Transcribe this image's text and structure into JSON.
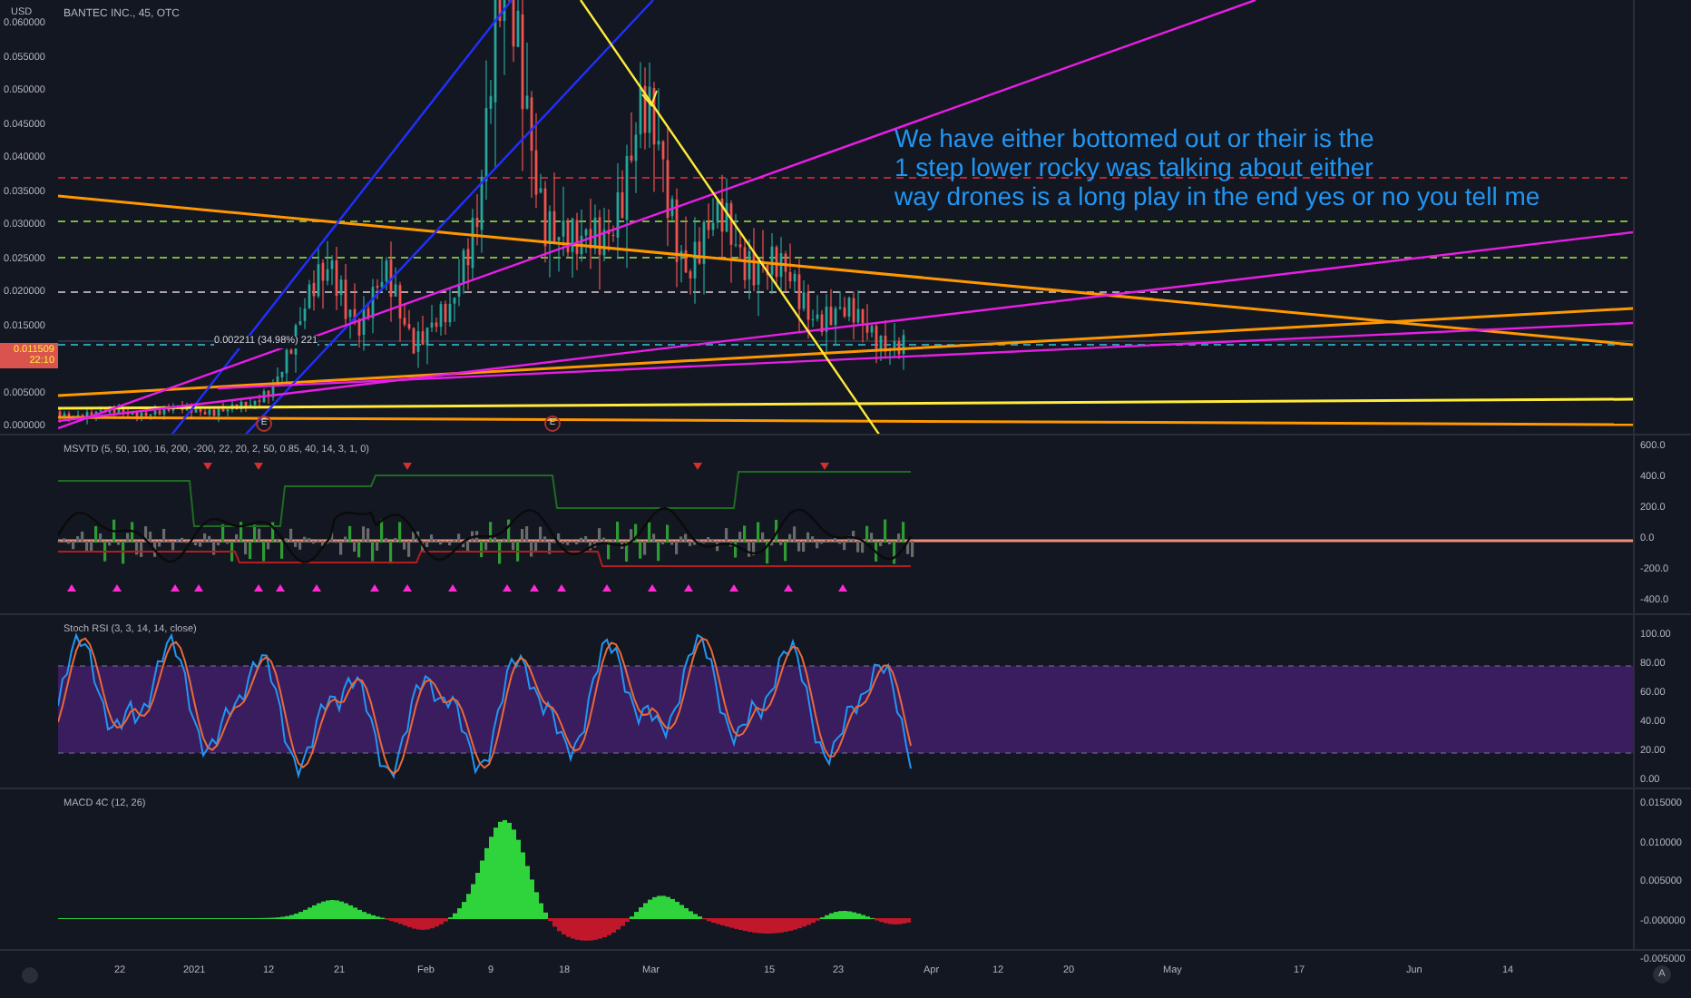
{
  "header": {
    "currency": "USD",
    "symbol": "BANTEC INC., 45, OTC"
  },
  "price_axis": {
    "labels": [
      "0.060000",
      "0.055000",
      "0.050000",
      "0.045000",
      "0.040000",
      "0.035000",
      "0.030000",
      "0.025000",
      "0.020000",
      "0.015000",
      "0.005000",
      "0.000000"
    ],
    "last_price": "0.011509",
    "countdown": "22:10"
  },
  "main_chart": {
    "measure_label": "0.002211 (34.98%) 221",
    "earnings_markers": [
      "E",
      "E"
    ],
    "note_lines": [
      "We have either bottomed out or their is the",
      "1 step lower rocky was talking about either",
      "way drones is a long play in the end yes or no you tell me"
    ]
  },
  "panes": [
    {
      "kind": "msvtd",
      "title": "MSVTD (5, 50, 100, 16, 200, -200, 22, 20, 2, 50, 0.85, 40, 14, 3, 1, 0)",
      "axis": [
        "600.0",
        "400.0",
        "200.0",
        "0.0",
        "-200.0",
        "-400.0"
      ]
    },
    {
      "kind": "stoch",
      "title": "Stoch RSI (3, 3, 14, 14, close)",
      "axis": [
        "100.00",
        "80.00",
        "60.00",
        "40.00",
        "20.00",
        "0.00"
      ]
    },
    {
      "kind": "macd",
      "title": "MACD 4C (12, 26)",
      "axis": [
        "0.015000",
        "0.010000",
        "0.005000",
        "-0.000000",
        "-0.005000"
      ]
    }
  ],
  "time_axis": {
    "labels": [
      "22",
      "2021",
      "12",
      "21",
      "Feb",
      "9",
      "18",
      "Mar",
      "15",
      "23",
      "Apr",
      "12",
      "20",
      "May",
      "17",
      "Jun",
      "14"
    ],
    "auto_button": "A"
  }
}
